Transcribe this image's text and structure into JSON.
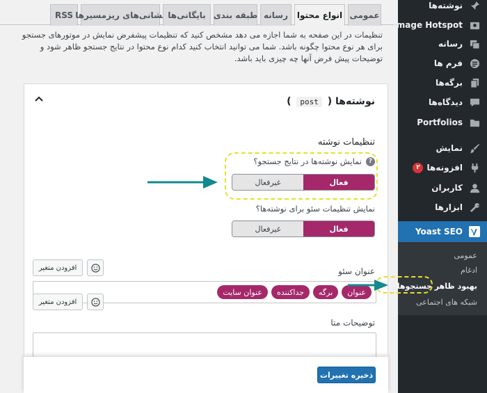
{
  "tabs": [
    "عمومی",
    "انواع محتوا",
    "رسانه",
    "طبقه بندی",
    "بایگانی‌ها",
    "نشانی‌های ریزمسیرها",
    "RSS"
  ],
  "active_tab": "انواع محتوا",
  "intro_text": "تنظیمات در این صفحه به شما اجازه می دهد مشخص کنید که تنظیمات پیشفرض نمایش در موتورهای جستجو برای هر نوع محتوا چگونه باشد. شما می توانید انتخاب کنید کدام نوع محتوا در نتایج جستجو ظاهر شود و توضیحات پیش فرض آنها چه چیزی باید باشد.",
  "card": {
    "title": "نوشته‌ها",
    "slug": "post",
    "section_title": "تنظیمات نوشته",
    "q1": "نمایش نوشته‌ها در نتایج جستجو؟",
    "q2": "نمایش تنظیمات سئو برای نوشته‌ها؟",
    "toggle_on": "فعال",
    "toggle_off": "غیرفعال",
    "seo_title_label": "عنوان سئو",
    "meta_desc_label": "توضیحات متا",
    "add_variable": "افزودن متغیر",
    "seo_pills": [
      "عنوان",
      "برگه",
      "جداکننده",
      "عنوان سایت"
    ]
  },
  "save_button": "ذخیره تغییرات",
  "sidebar": {
    "items": [
      {
        "label": "نوشته‌ها",
        "icon": "pin-icon"
      },
      {
        "label": "Image Hotspot",
        "icon": "image-icon"
      },
      {
        "label": "رسانه",
        "icon": "media-icon"
      },
      {
        "label": "فرم ها",
        "icon": "form-icon"
      },
      {
        "label": "برگه‌ها",
        "icon": "page-icon"
      },
      {
        "label": "دیدگاه‌ها",
        "icon": "comment-icon"
      },
      {
        "label": "Portfolios",
        "icon": "folder-icon"
      },
      {
        "label": "نمایش",
        "icon": "brush-icon"
      },
      {
        "label": "افزونه‌ها",
        "icon": "plugin-icon",
        "badge": "۲"
      },
      {
        "label": "کاربران",
        "icon": "user-icon"
      },
      {
        "label": "ابزارها",
        "icon": "wrench-icon"
      }
    ],
    "active": {
      "label": "Yoast SEO",
      "icon": "yoast-icon"
    },
    "submenu": [
      "عمومی",
      "ادغام",
      "بهبود ظاهر جستجوها",
      "شبکه های اجتماعی"
    ],
    "submenu_current": "بهبود ظاهر جستجوها"
  },
  "colors": {
    "accent": "#a4286a",
    "wp_blue": "#2271b1",
    "sidebar": "#23282d",
    "highlight": "#e6e02a",
    "arrow": "#13888f"
  }
}
